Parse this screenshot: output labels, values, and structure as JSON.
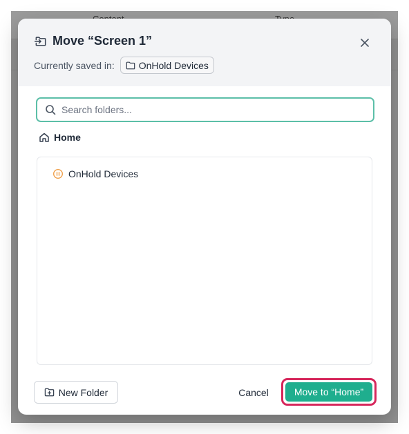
{
  "background": {
    "columns": [
      "Content",
      "Type"
    ]
  },
  "dialog": {
    "title": "Move “Screen 1”",
    "currently_saved_label": "Currently saved in:",
    "current_folder": "OnHold Devices",
    "search": {
      "placeholder": "Search folders...",
      "value": ""
    },
    "breadcrumb": "Home",
    "folders": [
      {
        "name": "OnHold Devices",
        "icon": "pause-circle-icon",
        "color": "#f0a04b"
      }
    ],
    "buttons": {
      "new_folder": "New Folder",
      "cancel": "Cancel",
      "move": "Move to “Home”"
    }
  },
  "colors": {
    "primary": "#1fae8e",
    "focus_ring": "#5cbfa8",
    "highlight": "#d6265b",
    "header_bg": "#f3f4f6"
  }
}
